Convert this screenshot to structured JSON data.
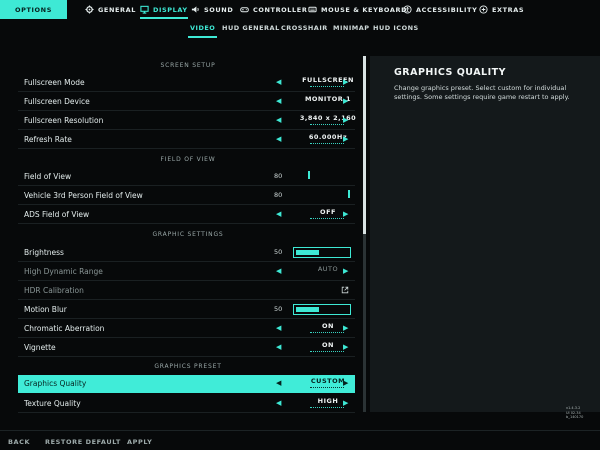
{
  "topbar": {
    "options_label": "OPTIONS",
    "tabs": [
      {
        "label": "GENERAL",
        "icon": "gear-icon"
      },
      {
        "label": "DISPLAY",
        "icon": "monitor-icon"
      },
      {
        "label": "SOUND",
        "icon": "speaker-icon"
      },
      {
        "label": "CONTROLLER",
        "icon": "gamepad-icon"
      },
      {
        "label": "MOUSE & KEYBOARD",
        "icon": "mouse-icon"
      },
      {
        "label": "ACCESSIBILITY",
        "icon": "accessibility-icon"
      },
      {
        "label": "EXTRAS",
        "icon": "plus-icon"
      }
    ],
    "active_tab": "DISPLAY"
  },
  "subtabs": {
    "items": [
      "VIDEO",
      "HUD GENERAL",
      "CROSSHAIR",
      "MINIMAP",
      "HUD ICONS"
    ],
    "active": "VIDEO"
  },
  "sections": {
    "screen_setup": "SCREEN SETUP",
    "field_of_view": "FIELD OF VIEW",
    "graphic_settings": "GRAPHIC SETTINGS",
    "graphics_preset": "GRAPHICS PRESET"
  },
  "settings": {
    "fullscreen_mode": {
      "label": "Fullscreen Mode",
      "value": "FULLSCREEN"
    },
    "fullscreen_device": {
      "label": "Fullscreen Device",
      "value": "MONITOR 1"
    },
    "fullscreen_resolution": {
      "label": "Fullscreen Resolution",
      "value": "3,840 x 2,160"
    },
    "refresh_rate": {
      "label": "Refresh Rate",
      "value": "60.000Hz"
    },
    "field_of_view": {
      "label": "Field of View",
      "value": "80"
    },
    "vehicle_fov": {
      "label": "Vehicle 3rd Person Field of View",
      "value": "80"
    },
    "ads_fov": {
      "label": "ADS Field of View",
      "value": "OFF"
    },
    "brightness": {
      "label": "Brightness",
      "value": "50",
      "level": 0.45
    },
    "hdr_range": {
      "label": "High Dynamic Range",
      "value": "AUTO"
    },
    "hdr_calibration": {
      "label": "HDR Calibration"
    },
    "motion_blur": {
      "label": "Motion Blur",
      "value": "50",
      "level": 0.45
    },
    "chromatic_aberration": {
      "label": "Chromatic Aberration",
      "value": "ON"
    },
    "vignette": {
      "label": "Vignette",
      "value": "ON"
    },
    "graphics_quality": {
      "label": "Graphics Quality",
      "value": "CUSTOM"
    },
    "texture_quality": {
      "label": "Texture Quality",
      "value": "HIGH"
    }
  },
  "info": {
    "title": "GRAPHICS QUALITY",
    "description": "Change graphics preset. Select custom for individual settings. Some settings require game restart to apply."
  },
  "corner_text": [
    "v1.4.3.2",
    "UI 02.34",
    "b_140170"
  ],
  "footer": {
    "back": "BACK",
    "restore": "RESTORE DEFAULT",
    "apply": "APPLY"
  },
  "colors": {
    "accent": "#3ee9d5",
    "background": "#07090a",
    "panel": "#14191b"
  }
}
